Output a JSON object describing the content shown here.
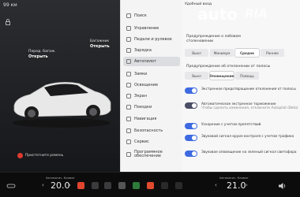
{
  "status": {
    "range": "99 км",
    "time": ""
  },
  "car": {
    "front_trunk_label": "Перед. багаж.",
    "front_trunk_action": "Открыть",
    "trunk_label": "Багажник",
    "trunk_action": "Открыть",
    "warning": "Пристегните ремень"
  },
  "menu": {
    "items": [
      {
        "label": "Поиск"
      },
      {
        "label": "Управление"
      },
      {
        "label": "Педали и рулевое"
      },
      {
        "label": "Зарядка"
      },
      {
        "label": "Автопилот"
      },
      {
        "label": "Замки"
      },
      {
        "label": "Освещение"
      },
      {
        "label": "Экран"
      },
      {
        "label": "Поездки"
      },
      {
        "label": "Навигация"
      },
      {
        "label": "Безопасность"
      },
      {
        "label": "Сервис"
      },
      {
        "label": "Программное обеспечение"
      }
    ],
    "active_index": 4
  },
  "settings": {
    "header": "Удобный вход",
    "fcw_title": "Предупреждение о лобовом столкновении",
    "fcw_options": [
      "Выкл",
      "Минимум",
      "Средне",
      "Раннее"
    ],
    "fcw_selected": 2,
    "ldw_title": "Предупреждение об отклонении от полосы",
    "ldw_options": [
      "Выкл",
      "Оповещение",
      "Помощь"
    ],
    "ldw_selected": 1,
    "toggles": [
      {
        "text": "Экстренное предотвращение отклонения от полосы",
        "sub": "",
        "on": true
      },
      {
        "text": "Автоматическое экстренное торможение",
        "sub": "Чтобы сделать изменения, отключите Autopilot (Beta)",
        "on": false
      },
      {
        "text": "Ускорение с учетом препятствий",
        "sub": "",
        "on": true
      },
      {
        "text": "Звуковой сигнал круиз-контроля с учетом трафика",
        "sub": "",
        "on": true
      },
      {
        "text": "Звуковое оповещение на зеленый сигнал светофора",
        "sub": "",
        "on": true
      }
    ]
  },
  "watermark": {
    "auto": "auto",
    "ria": "RIA"
  },
  "bottom": {
    "left_label": "Автоматич. Климат",
    "left_temp": "20.0",
    "right_label": "Автоматич. Климат",
    "right_temp": "21.0"
  },
  "colors": {
    "accent": "#3e6ae1",
    "car_bg": "#1f2023",
    "menu_bg": "#f4f4f5"
  }
}
